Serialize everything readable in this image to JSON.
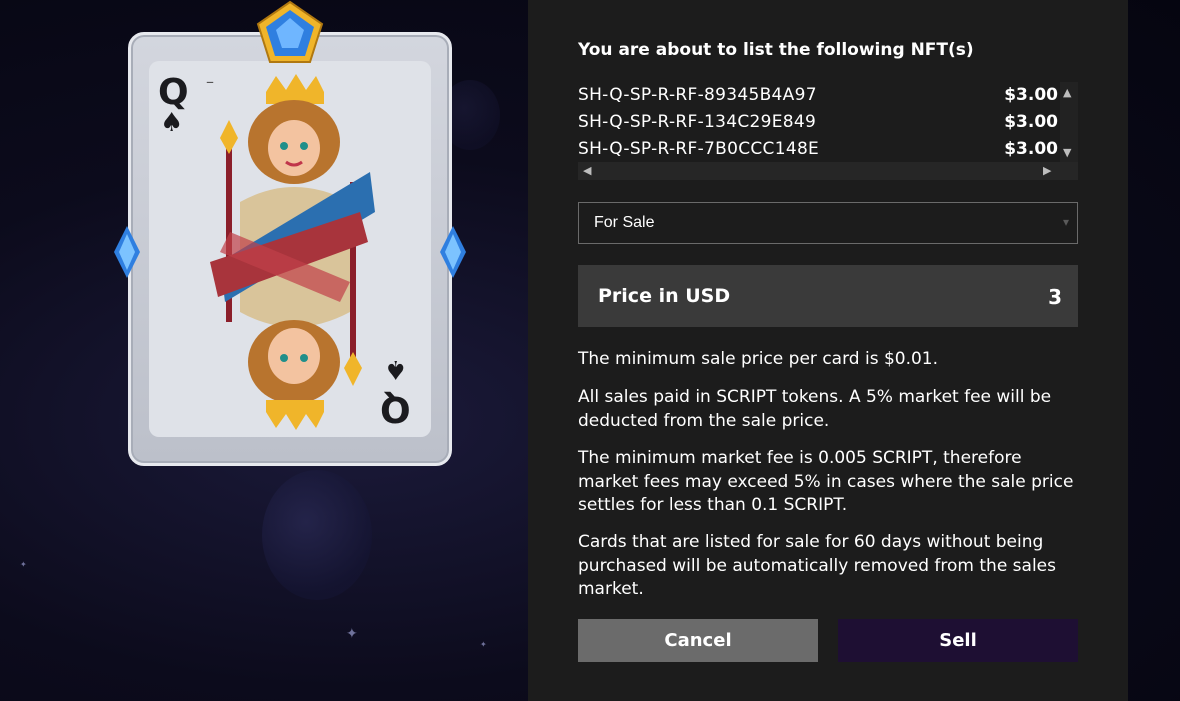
{
  "card": {
    "rank": "Q",
    "suit": "♠",
    "dash": "–"
  },
  "modal": {
    "title": "You are about to list the following NFT(s)",
    "nfts": [
      {
        "id": "SH-Q-SP-R-RF-89345B4A97",
        "price": "$3.00"
      },
      {
        "id": "SH-Q-SP-R-RF-134C29E849",
        "price": "$3.00"
      },
      {
        "id": "SH-Q-SP-R-RF-7B0CCC148E",
        "price": "$3.00"
      }
    ],
    "listing_type": {
      "selected": "For Sale"
    },
    "price": {
      "label": "Price in USD",
      "value": "3"
    },
    "info": [
      "The minimum sale price per card is $0.01.",
      "All sales paid in SCRIPT tokens. A 5% market fee will be deducted from the sale price.",
      "The minimum market fee is 0.005 SCRIPT, therefore market fees may exceed 5% in cases where the sale price settles for less than 0.1 SCRIPT.",
      "Cards that are listed for sale for 60 days without being purchased will be automatically removed from the sales market."
    ],
    "buttons": {
      "cancel": "Cancel",
      "sell": "Sell"
    }
  },
  "colors": {
    "panel_bg": "#1c1c1c",
    "price_box_bg": "#3a3a3a",
    "cancel_bg": "#6b6b6b",
    "sell_bg": "#1e0f33",
    "gem_blue": "#2f7fe0",
    "crown_gold": "#f0b52a"
  }
}
